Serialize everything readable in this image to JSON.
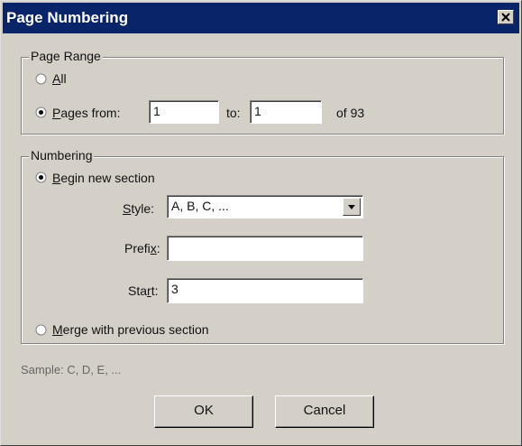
{
  "window": {
    "title": "Page Numbering"
  },
  "page_range": {
    "group_label": "Page Range",
    "all_label": "All",
    "all_accel": "A",
    "pages_from_label": "Pages  from:",
    "pages_from_accel": "P",
    "from_value": "1",
    "to_label": "to:",
    "to_value": "1",
    "of_label": "of 93",
    "selected": "pages"
  },
  "numbering": {
    "group_label": "Numbering",
    "begin_new_label": "Begin new section",
    "begin_new_accel": "B",
    "style_label": "Style:",
    "style_accel": "S",
    "style_value": "A, B, C, ...",
    "prefix_label": "Prefix:",
    "prefix_value": "",
    "start_label": "Start:",
    "start_value": "3",
    "merge_label": "Merge with previous section",
    "merge_accel": "M",
    "selected": "begin_new"
  },
  "sample": {
    "text": "Sample:   C, D, E, ..."
  },
  "buttons": {
    "ok_label": "OK",
    "cancel_label": "Cancel"
  },
  "icons": {
    "close": "close-icon",
    "dropdown": "chevron-down-icon",
    "radio_selected": "radio-selected-icon",
    "radio_unselected": "radio-unselected-icon"
  },
  "colors": {
    "titlebar": "#0a246a",
    "face": "#d4d0c8"
  }
}
